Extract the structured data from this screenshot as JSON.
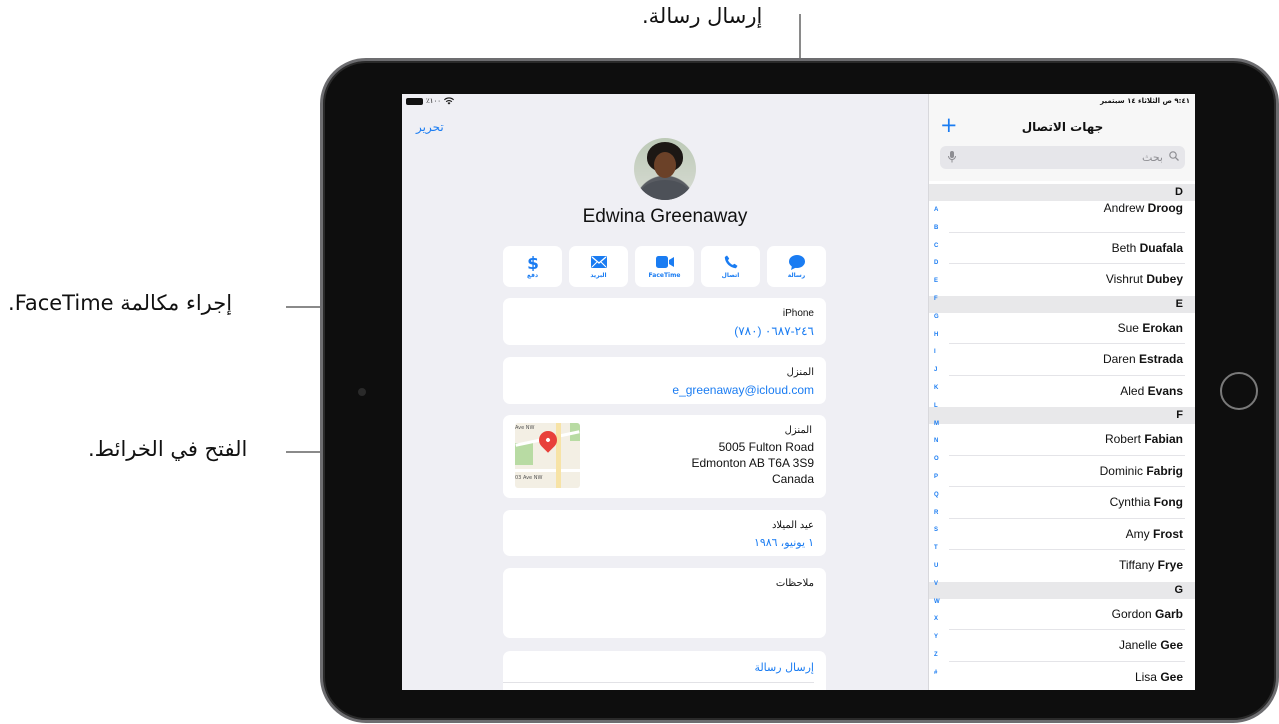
{
  "callouts": {
    "send_message": "إرسال رسالة.",
    "facetime_call": "إجراء مكالمة FaceTime.",
    "open_maps": "الفتح في الخرائط."
  },
  "detail_pane": {
    "status_bar": {
      "battery": "٪١٠٠"
    },
    "edit_label": "تحرير",
    "contact_name": "Edwina Greenaway",
    "actions": [
      {
        "icon": "message-icon",
        "label": "رسالة"
      },
      {
        "icon": "phone-icon",
        "label": "اتصال"
      },
      {
        "icon": "video-icon",
        "label": "FaceTime"
      },
      {
        "icon": "mail-icon",
        "label": "البريد"
      },
      {
        "icon": "dollar-icon",
        "label": "دفع"
      }
    ],
    "phone": {
      "label": "iPhone",
      "value": "(٧٨٠) ٢٤٦-٠٦٨٧"
    },
    "email": {
      "label": "المنزل",
      "value": "e_greenaway@icloud.com"
    },
    "address": {
      "label": "المنزل",
      "lines": [
        "5005 Fulton Road",
        "Edmonton AB T6A 3S9",
        "Canada"
      ],
      "map_labels": [
        "Ave NW",
        "03 Ave NW"
      ]
    },
    "birthday": {
      "label": "عيد الميلاد",
      "value": "١ يونيو، ١٩٨٦"
    },
    "notes": {
      "label": "ملاحظات",
      "value": ""
    },
    "send_message_label": "إرسال رسالة"
  },
  "list_pane": {
    "status_bar": "٩:٤١ ص  الثلاثاء ١٤ سبتمبر",
    "title": "جهات الاتصال",
    "add_label": "+",
    "search_placeholder": "بحث",
    "sections": [
      {
        "letter": "D",
        "contacts": [
          {
            "first": "Andrew",
            "last": "Droog"
          },
          {
            "first": "Beth",
            "last": "Duafala"
          },
          {
            "first": "Vishrut",
            "last": "Dubey"
          }
        ]
      },
      {
        "letter": "E",
        "contacts": [
          {
            "first": "Sue",
            "last": "Erokan"
          },
          {
            "first": "Daren",
            "last": "Estrada"
          },
          {
            "first": "Aled",
            "last": "Evans"
          }
        ]
      },
      {
        "letter": "F",
        "contacts": [
          {
            "first": "Robert",
            "last": "Fabian"
          },
          {
            "first": "Dominic",
            "last": "Fabrig"
          },
          {
            "first": "Cynthia",
            "last": "Fong"
          },
          {
            "first": "Amy",
            "last": "Frost"
          },
          {
            "first": "Tiffany",
            "last": "Frye"
          }
        ]
      },
      {
        "letter": "G",
        "contacts": [
          {
            "first": "Gordon",
            "last": "Garb"
          },
          {
            "first": "Janelle",
            "last": "Gee"
          },
          {
            "first": "Lisa",
            "last": "Gee"
          }
        ]
      }
    ],
    "index_letters": [
      "A",
      "B",
      "C",
      "D",
      "E",
      "F",
      "G",
      "H",
      "I",
      "J",
      "K",
      "L",
      "M",
      "N",
      "O",
      "P",
      "Q",
      "R",
      "S",
      "T",
      "U",
      "V",
      "W",
      "X",
      "Y",
      "Z",
      "#"
    ]
  },
  "colors": {
    "accent": "#1a7cf2",
    "pin": "#e8403a",
    "background": "#efeff4"
  }
}
